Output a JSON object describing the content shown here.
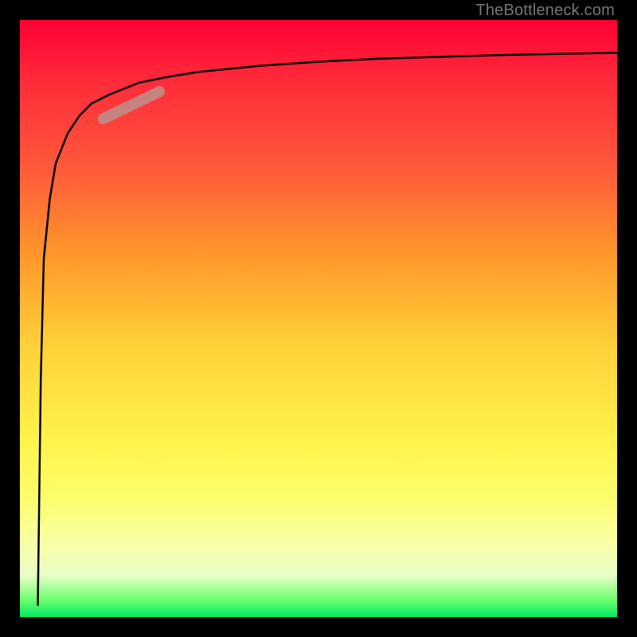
{
  "attribution": "TheBottleneck.com",
  "colors": {
    "frame": "#000000",
    "gradient_top": "#ff0033",
    "gradient_bottom": "#00e860",
    "curve": "#000000",
    "marker": "#c28b86"
  },
  "chart_data": {
    "type": "line",
    "title": "",
    "xlabel": "",
    "ylabel": "",
    "xlim": [
      0,
      100
    ],
    "ylim": [
      0,
      100
    ],
    "grid": false,
    "series": [
      {
        "name": "bottleneck-curve",
        "x": [
          3,
          3.5,
          4,
          5,
          6,
          8,
          10,
          12,
          15,
          20,
          25,
          30,
          40,
          50,
          60,
          70,
          80,
          90,
          100
        ],
        "y": [
          2,
          40,
          60,
          70,
          76,
          81,
          84,
          86,
          87.5,
          89.5,
          90.5,
          91.3,
          92.3,
          93,
          93.5,
          93.8,
          94.1,
          94.3,
          94.5
        ]
      }
    ],
    "marker": {
      "x": 19,
      "y": 85.5,
      "length": 8,
      "angle_deg": 30
    },
    "annotations": [
      {
        "text": "TheBottleneck.com",
        "position": "top-right"
      }
    ]
  }
}
